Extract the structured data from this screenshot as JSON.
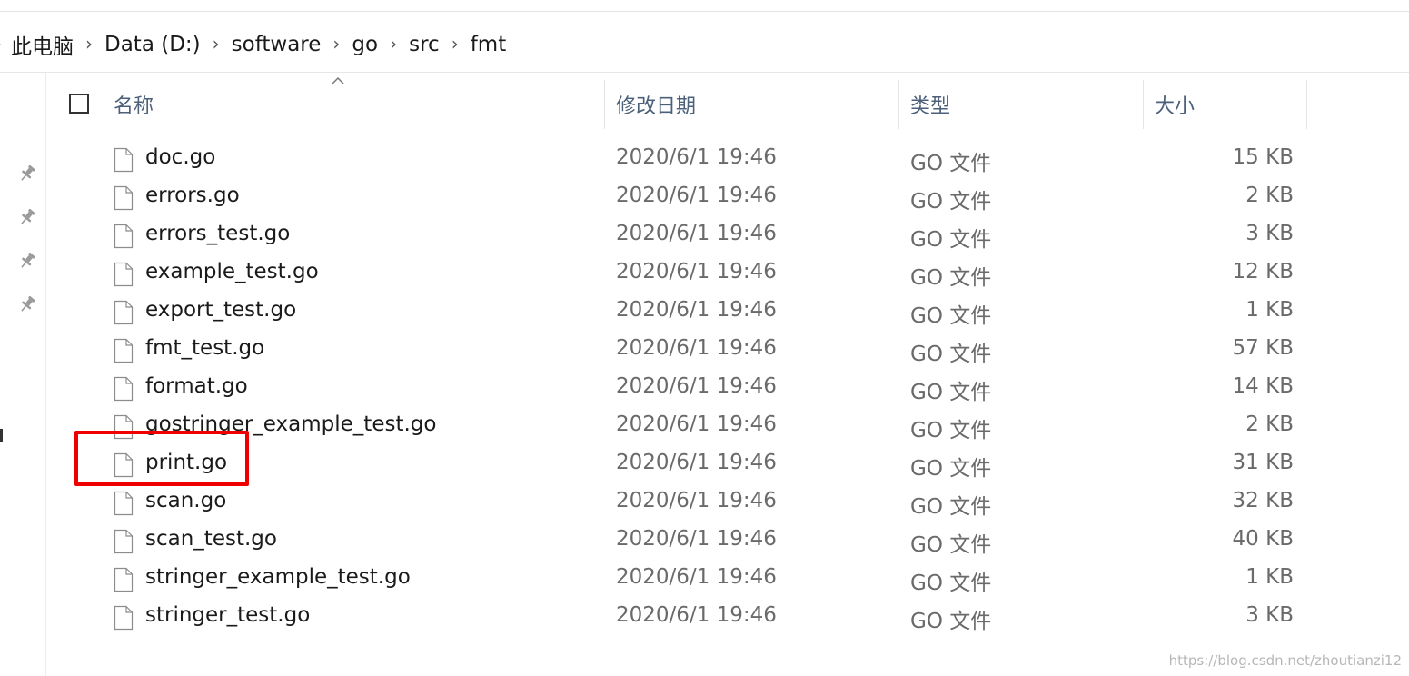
{
  "breadcrumb": [
    "此电脑",
    "Data (D:)",
    "software",
    "go",
    "src",
    "fmt"
  ],
  "columns": {
    "name": "名称",
    "modified": "修改日期",
    "type": "类型",
    "size": "大小"
  },
  "icons": {
    "pin": "pin-icon",
    "file": "file-icon",
    "sort": "sort-ascending-icon",
    "chevron": "chevron-right-icon"
  },
  "files": [
    {
      "name": "doc.go",
      "modified": "2020/6/1 19:46",
      "type": "GO 文件",
      "size": "15 KB"
    },
    {
      "name": "errors.go",
      "modified": "2020/6/1 19:46",
      "type": "GO 文件",
      "size": "2 KB"
    },
    {
      "name": "errors_test.go",
      "modified": "2020/6/1 19:46",
      "type": "GO 文件",
      "size": "3 KB"
    },
    {
      "name": "example_test.go",
      "modified": "2020/6/1 19:46",
      "type": "GO 文件",
      "size": "12 KB"
    },
    {
      "name": "export_test.go",
      "modified": "2020/6/1 19:46",
      "type": "GO 文件",
      "size": "1 KB"
    },
    {
      "name": "fmt_test.go",
      "modified": "2020/6/1 19:46",
      "type": "GO 文件",
      "size": "57 KB"
    },
    {
      "name": "format.go",
      "modified": "2020/6/1 19:46",
      "type": "GO 文件",
      "size": "14 KB"
    },
    {
      "name": "gostringer_example_test.go",
      "modified": "2020/6/1 19:46",
      "type": "GO 文件",
      "size": "2 KB"
    },
    {
      "name": "print.go",
      "modified": "2020/6/1 19:46",
      "type": "GO 文件",
      "size": "31 KB"
    },
    {
      "name": "scan.go",
      "modified": "2020/6/1 19:46",
      "type": "GO 文件",
      "size": "32 KB"
    },
    {
      "name": "scan_test.go",
      "modified": "2020/6/1 19:46",
      "type": "GO 文件",
      "size": "40 KB"
    },
    {
      "name": "stringer_example_test.go",
      "modified": "2020/6/1 19:46",
      "type": "GO 文件",
      "size": "1 KB"
    },
    {
      "name": "stringer_test.go",
      "modified": "2020/6/1 19:46",
      "type": "GO 文件",
      "size": "3 KB"
    }
  ],
  "highlighted_file": "print.go",
  "colors": {
    "header_text": "#4c607a",
    "highlight": "#ef0000",
    "secondary_text": "#6a6a6a"
  },
  "watermark": "https://blog.csdn.net/zhoutianzi12"
}
